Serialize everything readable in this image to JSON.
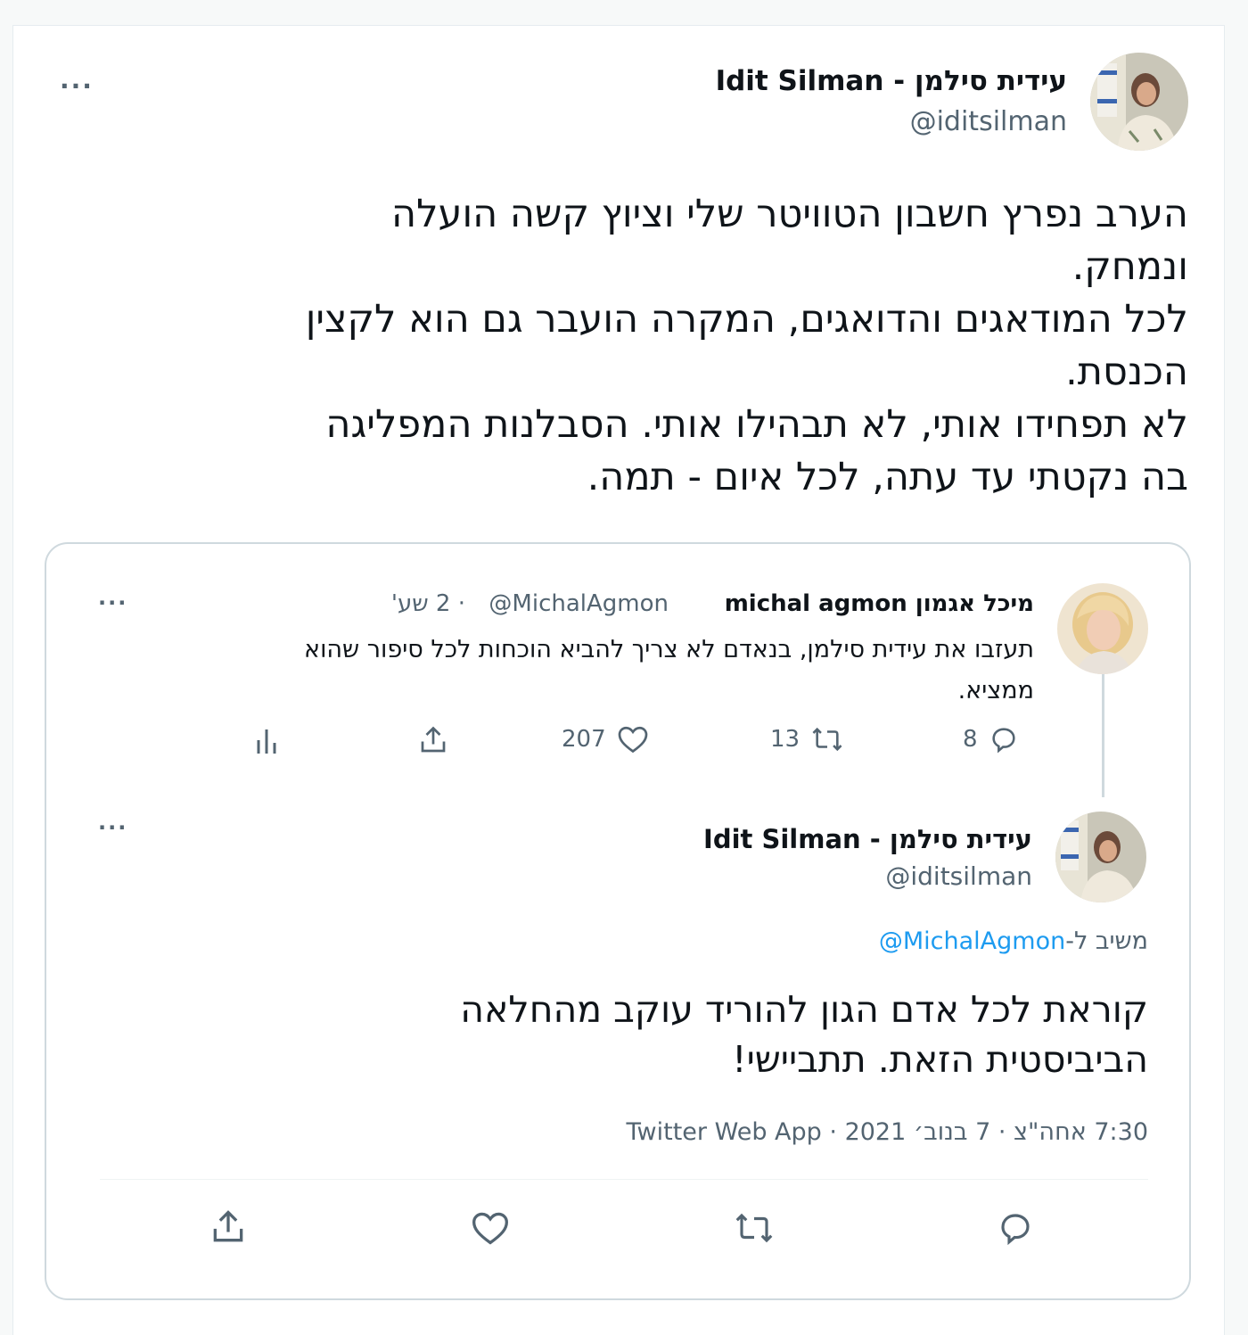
{
  "main_tweet": {
    "author_name": "עידית סילמן - Idit Silman",
    "handle": "@iditsilman",
    "text_lines": [
      "הערב נפרץ חשבון הטוויטר שלי וציוץ קשה הועלה",
      "ונמחק.",
      "לכל המודאגים והדואגים, המקרה הועבר גם הוא לקצין",
      "הכנסת.",
      "לא תפחידו אותי, לא תבהילו אותי. הסבלנות המפליגה",
      "בה נקטתי עד עתה, לכל איום - תמה."
    ]
  },
  "quoted_parent": {
    "author_name": "מיכל אגמון michal agmon",
    "handle": "@MichalAgmon",
    "time": "· 2 שע'",
    "text_lines": [
      "תעזבו את עידית סילמן, בנאדם לא צריך להביא הוכחות לכל סיפור שהוא",
      "ממציא."
    ],
    "replies": "8",
    "retweets": "13",
    "likes": "207"
  },
  "quoted_reply": {
    "author_name": "עידית סילמן - Idit Silman",
    "handle": "@iditsilman",
    "replying_prefix": "משיב ל-",
    "replying_to": "@MichalAgmon",
    "text_lines": [
      "קוראת לכל אדם הגון להוריד עוקב מהחלאה",
      "הביביסטית הזאת. תתביישי!"
    ],
    "timestamp": "7:30 אחה\"צ · 7 בנוב׳ 2021 · Twitter Web App"
  },
  "icons": {
    "more": "more-icon",
    "reply": "reply-icon",
    "retweet": "retweet-icon",
    "like": "like-icon",
    "share": "share-icon",
    "analytics": "analytics-icon"
  },
  "colors": {
    "text": "#0f1419",
    "secondary": "#536471",
    "link": "#1d9bf0",
    "border": "#cfd9de"
  }
}
